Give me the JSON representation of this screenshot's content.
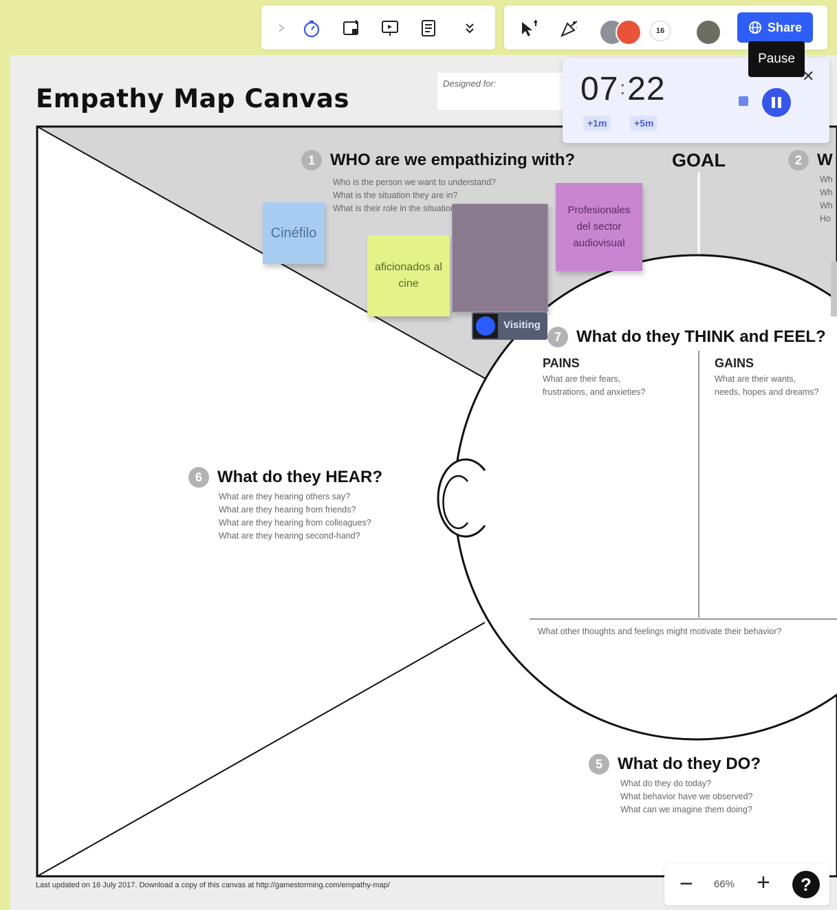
{
  "toolbar_left": {
    "icons": [
      "chevron-right-icon",
      "timer-icon",
      "sticky-note-icon",
      "presentation-icon",
      "notes-icon",
      "chevron-double-down-icon"
    ]
  },
  "toolbar_right": {
    "collaborator_count": "16",
    "share_label": "Share"
  },
  "timer": {
    "minutes": "07",
    "seconds": "22",
    "add_1m": "+1m",
    "add_5m": "+5m",
    "tooltip": "Pause"
  },
  "canvas": {
    "title": "Empathy Map Canvas",
    "designed_for_label": "Designed for:",
    "goal_label": "GOAL",
    "footer": "Last updated on 16 July 2017. Download a copy of this canvas at http://gamestorming.com/empathy-map/"
  },
  "sections": {
    "who": {
      "number": "1",
      "title": "WHO are we empathizing with?",
      "questions": [
        "Who is the person we want to understand?",
        "What is the situation they are in?",
        "What is their role in the situation?"
      ]
    },
    "what": {
      "number": "2",
      "title": "W",
      "questions": [
        "Wh",
        "Wh",
        "Wh",
        "Ho"
      ]
    },
    "think_feel": {
      "number": "7",
      "title": "What do they THINK and FEEL?",
      "pains_title": "PAINS",
      "pains_questions": [
        "What are their fears,",
        "frustrations, and anxieties?"
      ],
      "gains_title": "GAINS",
      "gains_questions": [
        "What are their wants,",
        "needs, hopes and dreams?"
      ],
      "footer": "What other thoughts and feelings might motivate their behavior?"
    },
    "hear": {
      "number": "6",
      "title": "What do they HEAR?",
      "questions": [
        "What are they hearing others say?",
        "What are they hearing from friends?",
        "What are they hearing from colleagues?",
        "What are they hearing second-hand?"
      ]
    },
    "do": {
      "number": "5",
      "title": "What do they DO?",
      "questions": [
        "What do they do today?",
        "What behavior have we observed?",
        "What can we imagine them doing?"
      ]
    }
  },
  "stickies": [
    {
      "text": "Cinéfilo",
      "color": "#a9cdf2"
    },
    {
      "text": "aficionados al cine",
      "color": "#e4f28a"
    },
    {
      "text": "",
      "color": "#8a7a8e"
    },
    {
      "text": "Profesionales del sector audiovisual",
      "color": "#c786cf"
    }
  ],
  "visiting_label": "Visiting",
  "zoom": {
    "minus": "−",
    "value": "66%",
    "plus": "+",
    "help": "?"
  },
  "colors": {
    "accent": "#2e5ef5",
    "background": "#e7ec9f",
    "board": "#ededed"
  }
}
